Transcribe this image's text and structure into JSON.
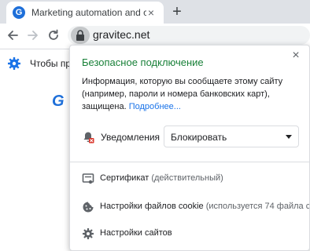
{
  "tab": {
    "favicon_letter": "G",
    "title": "Marketing automation and conte",
    "close": "×",
    "new_tab": "+"
  },
  "toolbar": {
    "url": "gravitec.net"
  },
  "infobar": {
    "text": "Чтобы пр"
  },
  "page": {
    "logo_letter": "G"
  },
  "popup": {
    "close": "×",
    "title": "Безопасное подключение",
    "description": "Информация, которую вы сообщаете этому сайту (например, пароли и номера банковских карт), защищена.",
    "more_link": "Подробнее...",
    "permission": {
      "label": "Уведомления",
      "value": "Блокировать"
    },
    "menu": [
      {
        "label": "Сертификат",
        "sub": " (действительный)",
        "icon": "certificate-icon"
      },
      {
        "label": "Настройки файлов cookie",
        "sub": " (используется 74 файла coo",
        "icon": "cookie-icon"
      },
      {
        "label": "Настройки сайтов",
        "sub": "",
        "icon": "gear-icon"
      }
    ]
  },
  "colors": {
    "secure_green": "#188038",
    "link_blue": "#1a73e8",
    "gravitec_blue": "#1e6fd9"
  }
}
